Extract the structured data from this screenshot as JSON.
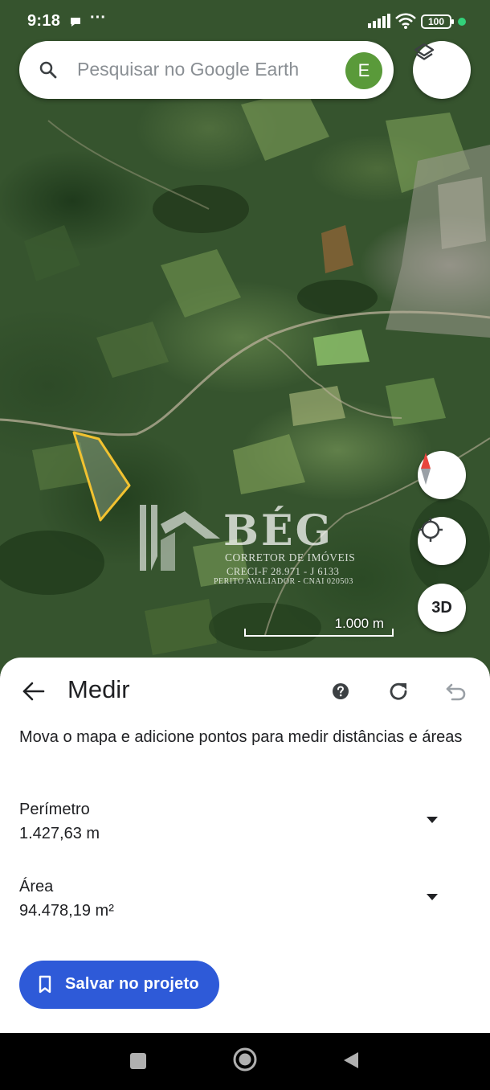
{
  "status_bar": {
    "time": "9:18",
    "dots": "···",
    "battery": "100",
    "icons": [
      "chat-bubble-icon",
      "signal-icon",
      "wifi-icon",
      "battery-icon"
    ]
  },
  "search": {
    "placeholder": "Pesquisar no Google Earth",
    "avatar_letter": "E",
    "avatar_color": "#5a9a3a"
  },
  "map": {
    "scale_label": "1.000 m",
    "outline_color": "#f2c230",
    "controls": [
      "compass",
      "my-location",
      "3D"
    ],
    "view3d_label": "3D"
  },
  "watermark": {
    "brand": "BÉG",
    "line1": "CORRETOR DE IMÓVEIS",
    "line2": "CRECI-F 28.971 - J 6133",
    "line3": "PERITO AVALIADOR - CNAI 020503"
  },
  "measure": {
    "title": "Medir",
    "instructions": "Mova o mapa e adicione pontos para medir distâncias e áreas",
    "perimeter": {
      "label": "Perímetro",
      "value": "1.427,63 m"
    },
    "area": {
      "label": "Área",
      "value": "94.478,19 m²"
    },
    "save_label": "Salvar no projeto",
    "accent_color": "#2e5ad8"
  }
}
